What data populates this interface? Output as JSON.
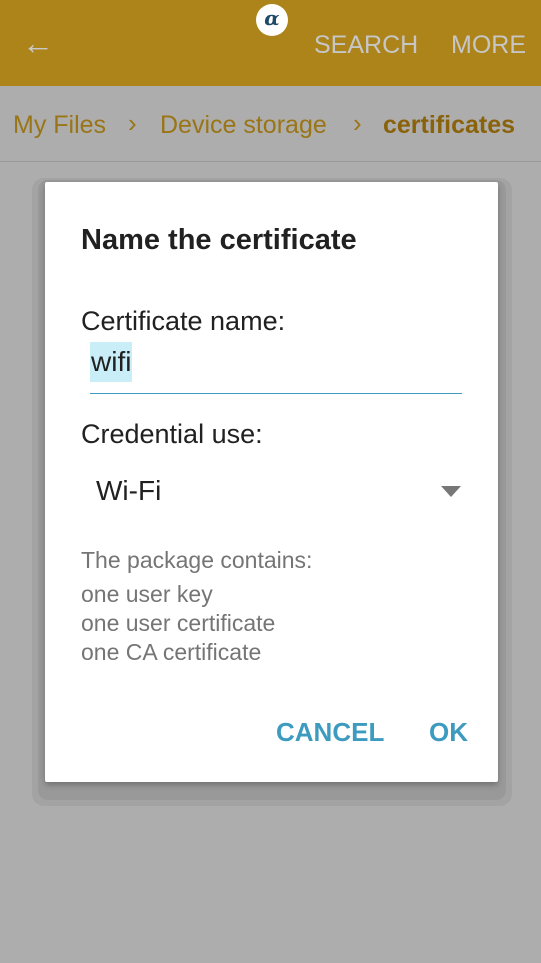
{
  "appbar": {
    "back_icon": "arrow-left-icon",
    "logo": "α",
    "search": "SEARCH",
    "more": "MORE",
    "color": "#ad841a"
  },
  "breadcrumb": [
    "My Files",
    "Device storage",
    "certificates"
  ],
  "dialog": {
    "title": "Name the certificate",
    "name_label": "Certificate name:",
    "name_value": "wifi",
    "use_label": "Credential use:",
    "use_value": "Wi-Fi",
    "info": [
      "The package contains:",
      "one user key",
      "one user certificate",
      "one CA certificate"
    ],
    "cancel": "CANCEL",
    "ok": "OK",
    "accent": "#3d9bbf"
  }
}
